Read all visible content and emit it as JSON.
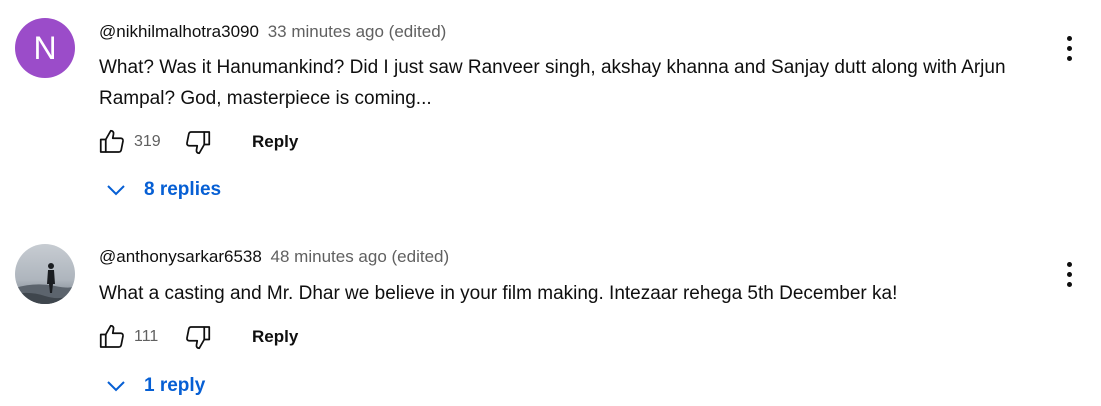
{
  "comments": [
    {
      "avatar_letter": "N",
      "avatar_color": "#9b4cc9",
      "author": "@nikhilmalhotra3090",
      "time": "33 minutes ago (edited)",
      "text": "What? Was it Hanumankind? Did I just saw Ranveer singh, akshay khanna and Sanjay dutt along with Arjun Rampal? God, masterpiece is coming...",
      "likes": "319",
      "reply_label": "Reply",
      "replies_label": "8 replies"
    },
    {
      "avatar_icon": "person-silhouette-photo",
      "author": "@anthonysarkar6538",
      "time": "48 minutes ago (edited)",
      "text": "What a casting and Mr. Dhar we believe in your film making. Intezaar rehega 5th December ka!",
      "likes": "111",
      "reply_label": "Reply",
      "replies_label": "1 reply"
    }
  ],
  "colors": {
    "link": "#065fd4",
    "meta": "#606060",
    "text": "#0f0f0f"
  }
}
